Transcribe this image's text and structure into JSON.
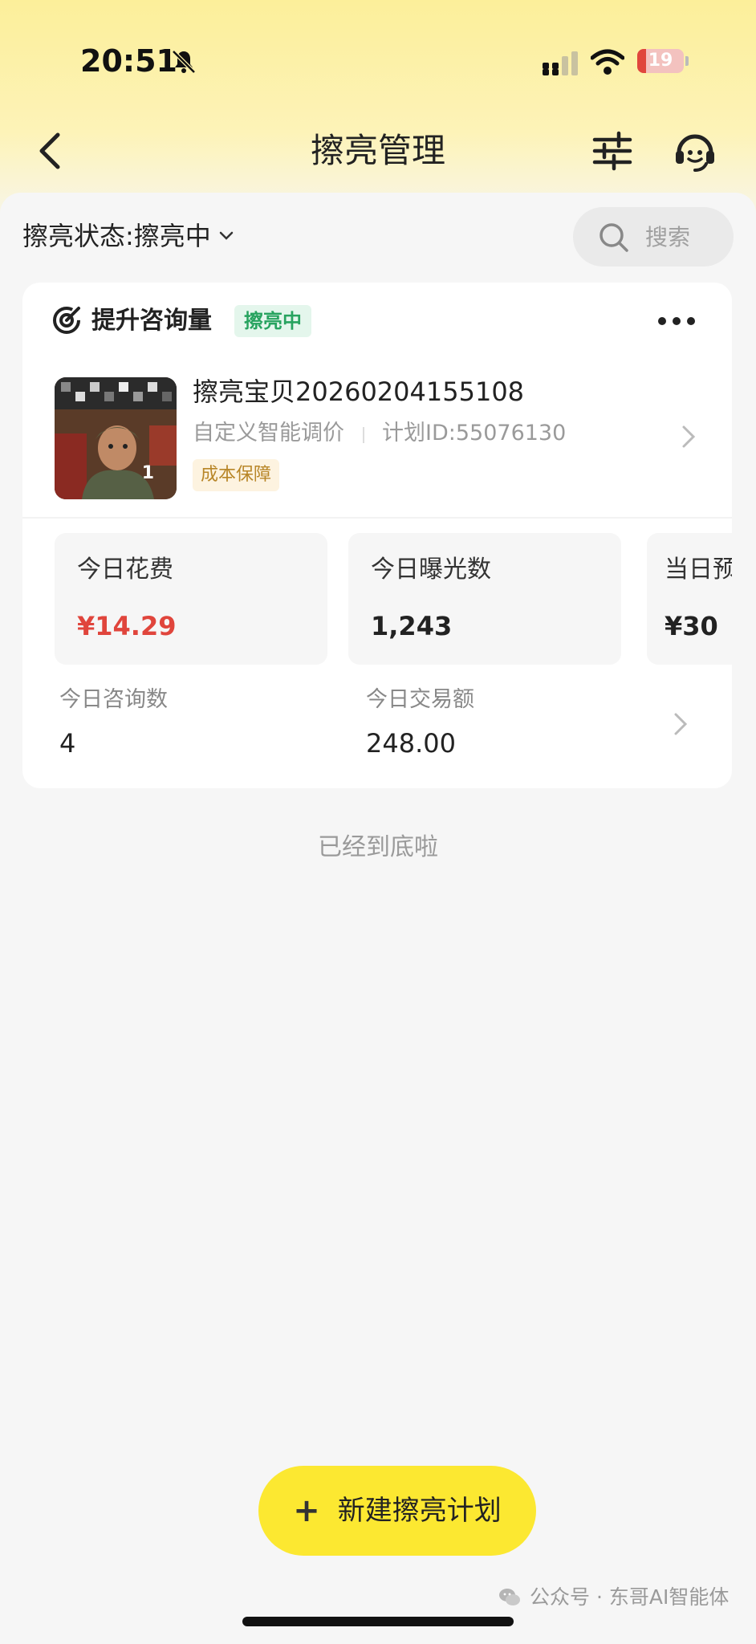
{
  "status_bar": {
    "time": "20:51",
    "battery_level": "19",
    "battery_fraction": 0.19,
    "bell_icon": "bell-slash-icon",
    "signal_icon": "cellular-signal-icon",
    "wifi_icon": "wifi-icon"
  },
  "nav": {
    "title": "擦亮管理",
    "back_icon": "chevron-left-icon",
    "filter_icon": "sliders-icon",
    "support_icon": "customer-service-icon"
  },
  "filter": {
    "status_label": "擦亮状态:擦亮中",
    "search_placeholder": "搜索"
  },
  "plan_card": {
    "goal_title": "提升咨询量",
    "status_badge": "擦亮中",
    "product_name": "擦亮宝贝20260204155108",
    "pricing_mode": "自定义智能调价",
    "plan_id": "计划ID:55076130",
    "cost_badge": "成本保障",
    "thumb_count": "1",
    "metrics": [
      {
        "label": "今日花费",
        "value": "¥14.29"
      },
      {
        "label": "今日曝光数",
        "value": "1,243"
      },
      {
        "label": "当日预",
        "value": "¥30"
      }
    ],
    "stats": [
      {
        "label": "今日咨询数",
        "value": "4"
      },
      {
        "label": "今日交易额",
        "value": "248.00"
      }
    ]
  },
  "end_text": "已经到底啦",
  "new_plan_button": {
    "plus": "+",
    "label": "新建擦亮计划"
  },
  "watermark": "公众号 · 东哥AI智能体",
  "colors": {
    "accent_yellow": "#fce831",
    "badge_green": "#27a35f",
    "spend_red": "#e0453c",
    "cost_badge_text": "#b88628"
  }
}
